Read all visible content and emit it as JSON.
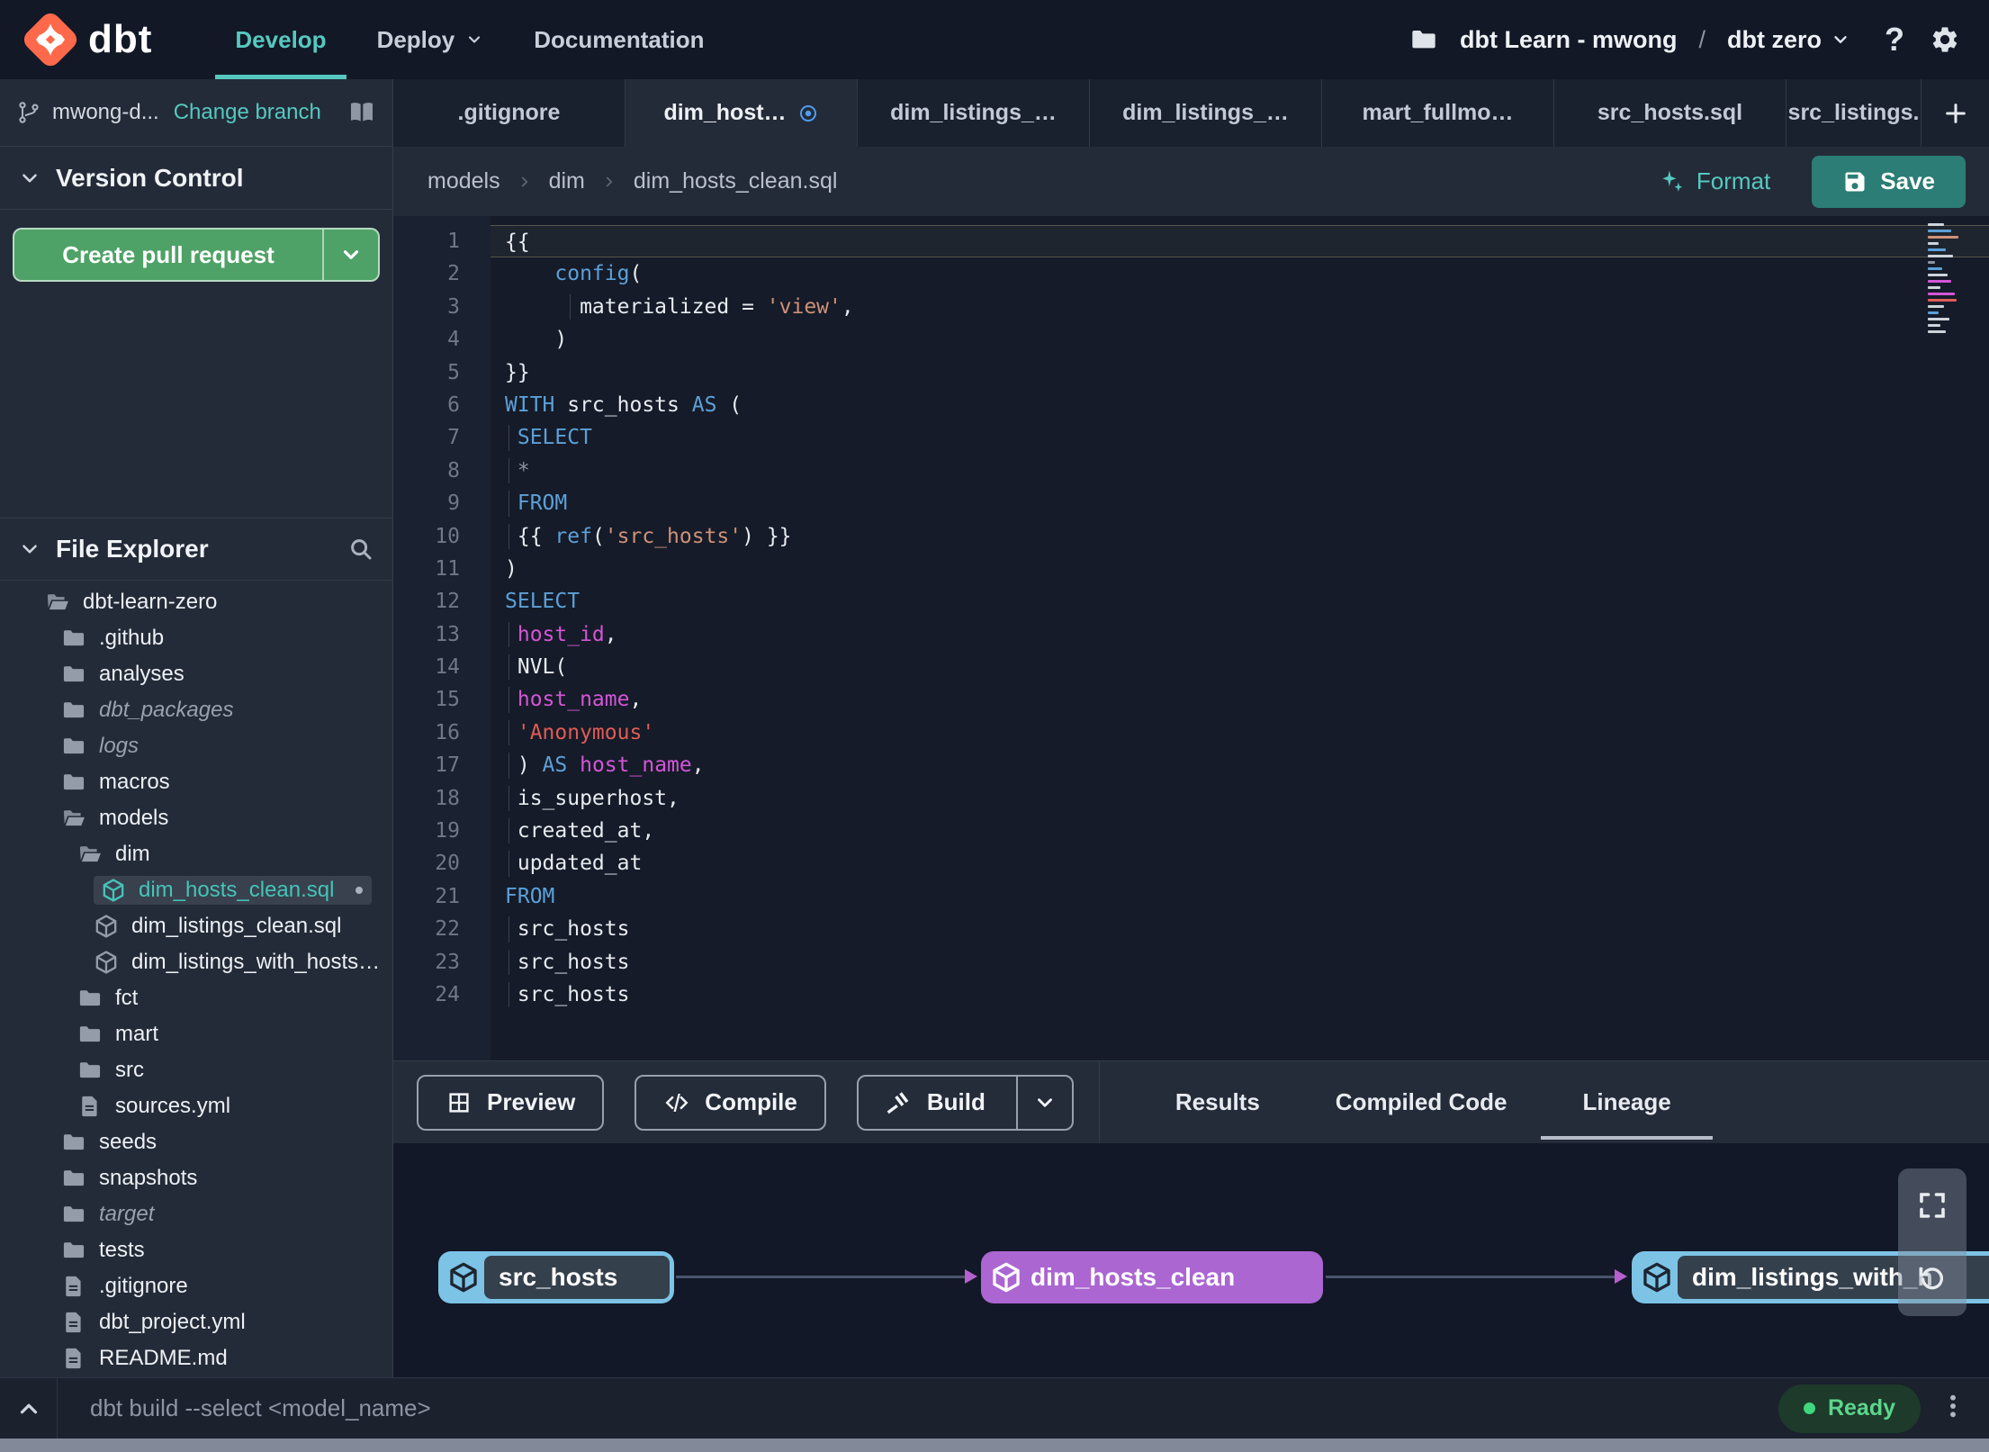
{
  "header": {
    "logo_text": "dbt",
    "nav_items": [
      {
        "label": "Develop",
        "active": true,
        "has_chevron": false
      },
      {
        "label": "Deploy",
        "active": false,
        "has_chevron": true
      },
      {
        "label": "Documentation",
        "active": false,
        "has_chevron": false
      }
    ],
    "project_name": "dbt Learn - mwong",
    "project_separator": "/",
    "environment_name": "dbt zero",
    "help_glyph": "?"
  },
  "branch_bar": {
    "branch_name": "mwong-d...",
    "change_branch_label": "Change branch"
  },
  "editor_tabs": [
    {
      "label": ".gitignore",
      "active": false,
      "modified": false,
      "clipped": false
    },
    {
      "label": "dim_host…",
      "active": true,
      "modified": true,
      "clipped": false
    },
    {
      "label": "dim_listings_…",
      "active": false,
      "modified": false,
      "clipped": false
    },
    {
      "label": "dim_listings_…",
      "active": false,
      "modified": false,
      "clipped": false
    },
    {
      "label": "mart_fullmo…",
      "active": false,
      "modified": false,
      "clipped": false
    },
    {
      "label": "src_hosts.sql",
      "active": false,
      "modified": false,
      "clipped": false
    },
    {
      "label": "src_listings.",
      "active": false,
      "modified": false,
      "clipped": true
    }
  ],
  "toolbar": {
    "breadcrumb": [
      "models",
      "dim",
      "dim_hosts_clean.sql"
    ],
    "format_label": "Format",
    "save_label": "Save"
  },
  "version_control": {
    "title": "Version Control",
    "create_pr_label": "Create pull request"
  },
  "file_explorer": {
    "title": "File Explorer",
    "items": [
      {
        "label": "dbt-learn-zero",
        "type": "folder-open",
        "depth": 0,
        "italic": false,
        "selected": false,
        "modified": false
      },
      {
        "label": ".github",
        "type": "folder",
        "depth": 1,
        "italic": false,
        "selected": false,
        "modified": false
      },
      {
        "label": "analyses",
        "type": "folder",
        "depth": 1,
        "italic": false,
        "selected": false,
        "modified": false
      },
      {
        "label": "dbt_packages",
        "type": "folder",
        "depth": 1,
        "italic": true,
        "selected": false,
        "modified": false
      },
      {
        "label": "logs",
        "type": "folder",
        "depth": 1,
        "italic": true,
        "selected": false,
        "modified": false
      },
      {
        "label": "macros",
        "type": "folder",
        "depth": 1,
        "italic": false,
        "selected": false,
        "modified": false
      },
      {
        "label": "models",
        "type": "folder-open",
        "depth": 1,
        "italic": false,
        "selected": false,
        "modified": false
      },
      {
        "label": "dim",
        "type": "folder-open",
        "depth": 2,
        "italic": false,
        "selected": false,
        "modified": false
      },
      {
        "label": "dim_hosts_clean.sql",
        "type": "model",
        "depth": 3,
        "italic": false,
        "selected": true,
        "modified": true
      },
      {
        "label": "dim_listings_clean.sql",
        "type": "model",
        "depth": 3,
        "italic": false,
        "selected": false,
        "modified": false
      },
      {
        "label": "dim_listings_with_hosts…",
        "type": "model",
        "depth": 3,
        "italic": false,
        "selected": false,
        "modified": false
      },
      {
        "label": "fct",
        "type": "folder",
        "depth": 2,
        "italic": false,
        "selected": false,
        "modified": false
      },
      {
        "label": "mart",
        "type": "folder",
        "depth": 2,
        "italic": false,
        "selected": false,
        "modified": false
      },
      {
        "label": "src",
        "type": "folder",
        "depth": 2,
        "italic": false,
        "selected": false,
        "modified": false
      },
      {
        "label": "sources.yml",
        "type": "file",
        "depth": 2,
        "italic": false,
        "selected": false,
        "modified": false
      },
      {
        "label": "seeds",
        "type": "folder",
        "depth": 1,
        "italic": false,
        "selected": false,
        "modified": false
      },
      {
        "label": "snapshots",
        "type": "folder",
        "depth": 1,
        "italic": false,
        "selected": false,
        "modified": false
      },
      {
        "label": "target",
        "type": "folder",
        "depth": 1,
        "italic": true,
        "selected": false,
        "modified": false
      },
      {
        "label": "tests",
        "type": "folder",
        "depth": 1,
        "italic": false,
        "selected": false,
        "modified": false
      },
      {
        "label": ".gitignore",
        "type": "file",
        "depth": 1,
        "italic": false,
        "selected": false,
        "modified": false
      },
      {
        "label": "dbt_project.yml",
        "type": "file",
        "depth": 1,
        "italic": false,
        "selected": false,
        "modified": false
      },
      {
        "label": "README.md",
        "type": "file",
        "depth": 1,
        "italic": false,
        "selected": false,
        "modified": false
      }
    ]
  },
  "editor": {
    "lines": [
      {
        "n": 1,
        "current": true,
        "guides": [],
        "seg": [
          [
            "pl",
            "{{"
          ]
        ]
      },
      {
        "n": 2,
        "current": false,
        "guides": [],
        "seg": [
          [
            "pl",
            "    "
          ],
          [
            "kw",
            "config"
          ],
          [
            "pl",
            "("
          ]
        ]
      },
      {
        "n": 3,
        "current": false,
        "guides": [
          5.2
        ],
        "seg": [
          [
            "pl",
            "      materialized = "
          ],
          [
            "str",
            "'view'"
          ],
          [
            "pl",
            ","
          ]
        ]
      },
      {
        "n": 4,
        "current": false,
        "guides": [],
        "seg": [
          [
            "pl",
            "    )"
          ]
        ]
      },
      {
        "n": 5,
        "current": false,
        "guides": [],
        "seg": [
          [
            "pl",
            "}}"
          ]
        ]
      },
      {
        "n": 6,
        "current": false,
        "guides": [],
        "seg": [
          [
            "kw",
            "WITH"
          ],
          [
            "pl",
            " src_hosts "
          ],
          [
            "kw",
            "AS"
          ],
          [
            "pl",
            " ("
          ]
        ]
      },
      {
        "n": 7,
        "current": false,
        "guides": [
          0.3
        ],
        "seg": [
          [
            "kw",
            " SELECT"
          ]
        ]
      },
      {
        "n": 8,
        "current": false,
        "guides": [
          0.3
        ],
        "seg": [
          [
            "dim",
            " *"
          ]
        ]
      },
      {
        "n": 9,
        "current": false,
        "guides": [
          0.3
        ],
        "seg": [
          [
            "kw",
            " FROM"
          ]
        ]
      },
      {
        "n": 10,
        "current": false,
        "guides": [
          0.3
        ],
        "seg": [
          [
            "pl",
            " {{ "
          ],
          [
            "kw",
            "ref"
          ],
          [
            "pl",
            "("
          ],
          [
            "str",
            "'src_hosts'"
          ],
          [
            "pl",
            ") }}"
          ]
        ]
      },
      {
        "n": 11,
        "current": false,
        "guides": [],
        "seg": [
          [
            "pl",
            ")"
          ]
        ]
      },
      {
        "n": 12,
        "current": false,
        "guides": [],
        "seg": [
          [
            "kw",
            "SELECT"
          ]
        ]
      },
      {
        "n": 13,
        "current": false,
        "guides": [
          0.3
        ],
        "seg": [
          [
            "mag",
            " host_id"
          ],
          [
            "pl",
            ","
          ]
        ]
      },
      {
        "n": 14,
        "current": false,
        "guides": [
          0.3
        ],
        "seg": [
          [
            "pl",
            " NVL("
          ]
        ]
      },
      {
        "n": 15,
        "current": false,
        "guides": [
          0.3
        ],
        "seg": [
          [
            "mag",
            " host_name"
          ],
          [
            "pl",
            ","
          ]
        ]
      },
      {
        "n": 16,
        "current": false,
        "guides": [
          0.3
        ],
        "seg": [
          [
            "red",
            " 'Anonymous'"
          ]
        ]
      },
      {
        "n": 17,
        "current": false,
        "guides": [
          0.3
        ],
        "seg": [
          [
            "pl",
            " ) "
          ],
          [
            "kw",
            "AS"
          ],
          [
            "pl",
            " "
          ],
          [
            "mag",
            "host_name"
          ],
          [
            "pl",
            ","
          ]
        ]
      },
      {
        "n": 18,
        "current": false,
        "guides": [
          0.3
        ],
        "seg": [
          [
            "pl",
            " is_superhost,"
          ]
        ]
      },
      {
        "n": 19,
        "current": false,
        "guides": [
          0.3
        ],
        "seg": [
          [
            "pl",
            " created_at,"
          ]
        ]
      },
      {
        "n": 20,
        "current": false,
        "guides": [
          0.3
        ],
        "seg": [
          [
            "pl",
            " updated_at"
          ]
        ]
      },
      {
        "n": 21,
        "current": false,
        "guides": [],
        "seg": [
          [
            "kw",
            "FROM"
          ]
        ]
      },
      {
        "n": 22,
        "current": false,
        "guides": [
          0.3
        ],
        "seg": [
          [
            "pl",
            " src_hosts"
          ]
        ]
      },
      {
        "n": 23,
        "current": false,
        "guides": [
          0.3
        ],
        "seg": [
          [
            "pl",
            " src_hosts"
          ]
        ]
      },
      {
        "n": 24,
        "current": false,
        "guides": [
          0.3
        ],
        "seg": [
          [
            "pl",
            " src_hosts"
          ]
        ]
      }
    ]
  },
  "bottom_panel": {
    "buttons": [
      {
        "label": "Preview",
        "icon": "grid-icon",
        "split": false
      },
      {
        "label": "Compile",
        "icon": "code-icon",
        "split": false
      },
      {
        "label": "Build",
        "icon": "hammer-icon",
        "split": true
      }
    ],
    "tabs": [
      {
        "label": "Results",
        "active": false
      },
      {
        "label": "Compiled Code",
        "active": false
      },
      {
        "label": "Lineage",
        "active": true
      }
    ]
  },
  "lineage": {
    "nodes": [
      {
        "label": "src_hosts",
        "type": "source"
      },
      {
        "label": "dim_hosts_clean",
        "type": "model"
      },
      {
        "label": "dim_listings_with_h",
        "type": "source"
      }
    ]
  },
  "command_bar": {
    "command_placeholder": "dbt build --select <model_name>",
    "status_label": "Ready"
  },
  "colors": {
    "accent_teal": "#52c5bd",
    "logo_orange": "#ff694b",
    "pr_green": "#4fa267",
    "save_teal": "#2b7d75",
    "node_blue": "#7cc3e6",
    "node_purple": "#ab66d2",
    "status_green": "#3ed77e",
    "keyword_blue": "#5ca0d8",
    "string_salmon": "#cf9178",
    "string_red": "#e05b56",
    "identifier_magenta": "#d455d8"
  }
}
